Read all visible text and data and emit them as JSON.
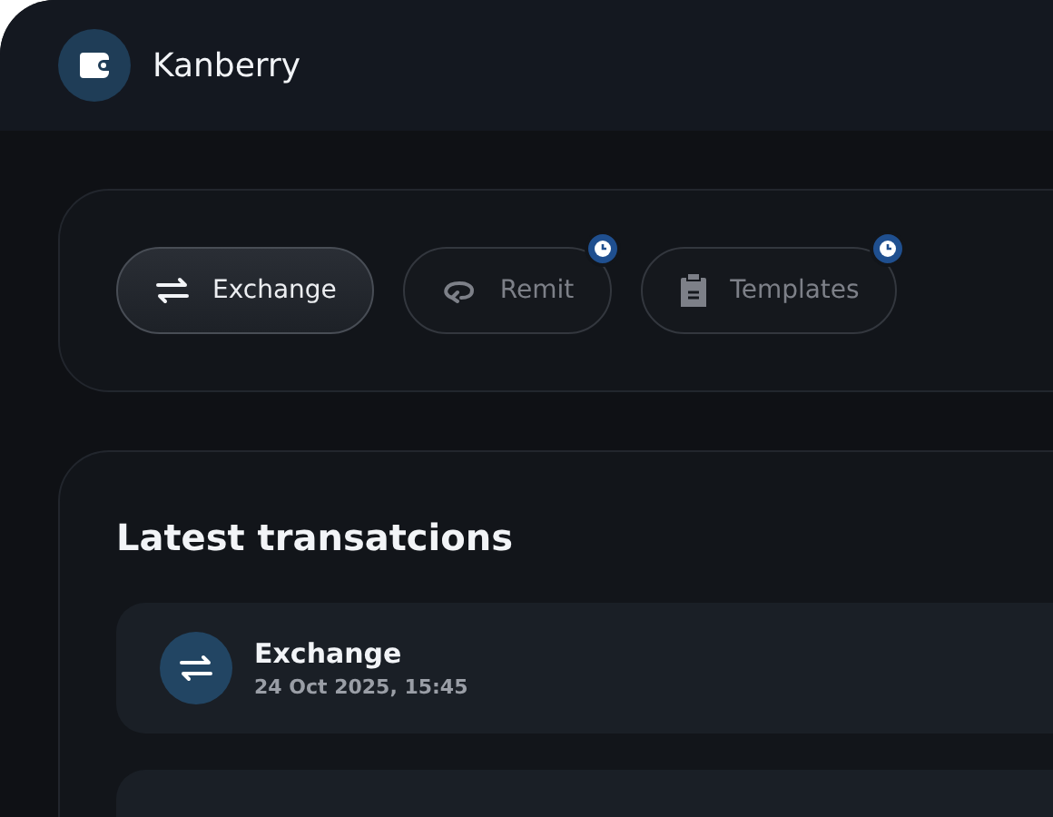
{
  "header": {
    "title": "Kanberry"
  },
  "actions": [
    {
      "label": "Exchange",
      "kind": "exchange",
      "selected": true,
      "disabled": false,
      "pending": false
    },
    {
      "label": "Remit",
      "kind": "remit",
      "selected": false,
      "disabled": true,
      "pending": true
    },
    {
      "label": "Templates",
      "kind": "clipboard",
      "selected": false,
      "disabled": true,
      "pending": true
    }
  ],
  "transactions": {
    "title": "Latest transatcions",
    "items": [
      {
        "name": "Exchange",
        "date": "24 Oct 2025, 15:45",
        "kind": "exchange"
      }
    ]
  }
}
